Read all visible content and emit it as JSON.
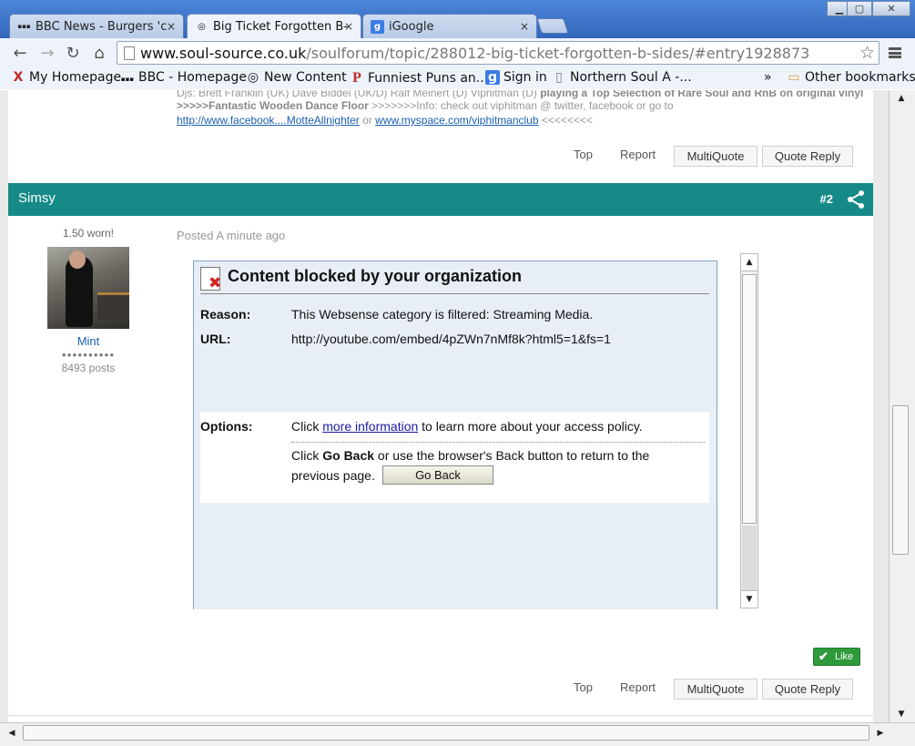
{
  "tabs": [
    {
      "icon": "bbc-favicon-icon",
      "label": "BBC News - Burgers 'c",
      "close": "×"
    },
    {
      "icon": "soul-source-favicon-icon",
      "label": "Big Ticket Forgotten B-",
      "close": "×"
    },
    {
      "icon": "google-favicon-icon",
      "label": "iGoogle",
      "close": "×"
    }
  ],
  "window_controls": {
    "minimize": "▁",
    "maximize": "▢",
    "close": "✕"
  },
  "toolbar": {
    "back": "←",
    "forward": "→",
    "reload": "↻",
    "home": "⌂",
    "url_host": "www.soul-source.co.uk",
    "url_path": "/soulforum/topic/288012-big-ticket-forgotten-b-sides/#entry1928873",
    "star": "☆"
  },
  "bookmarks": [
    {
      "icon": "x-favicon-icon",
      "glyph": "X",
      "label": "My Homepage"
    },
    {
      "icon": "bbc-favicon-icon",
      "glyph": "▪▪▪",
      "label": "BBC - Homepage"
    },
    {
      "icon": "soul-source-favicon-icon",
      "glyph": "◎",
      "label": "New Content"
    },
    {
      "icon": "p-favicon-icon",
      "glyph": "P",
      "label": "Funniest Puns an..."
    },
    {
      "icon": "google-favicon-icon",
      "glyph": "g",
      "label": "Sign in"
    },
    {
      "icon": "page-icon",
      "glyph": "▯",
      "label": "Northern Soul A -..."
    }
  ],
  "bookmarks_overflow": "»",
  "other_bookmarks": "Other bookmarks",
  "prev_post": {
    "line1": "Djs: Brett Franklin (UK) Dave Biddel (UK/D) Ralf Meinert (D) Viphitman (D)",
    "line1_bold": "playing a Top Selection of Rare Soul and RnB on original vinyl",
    "line2_bold": ">>>>>Fantastic Wooden Dance Floor",
    "line2": " >>>>>>>Info: check out viphitman @ twitter, facebook or go to",
    "link1": "http://www.facebook....MotteAllnighter",
    "or": " or ",
    "link2": " www.myspace.com/viphitmanclub",
    "tail": " <<<<<<<<"
  },
  "actions": {
    "top": "Top",
    "report": "Report",
    "multiquote": "MultiQuote",
    "quote_reply": "Quote Reply"
  },
  "post": {
    "author": "Simsy",
    "number": "#2",
    "reputation": "1.50 worn!",
    "member_title": "Mint",
    "pips": "●●●●●●●●●●",
    "post_count": "8493 posts",
    "posted": "Posted A minute ago"
  },
  "blocked": {
    "title": "Content blocked by your organization",
    "reason_label": "Reason:",
    "reason_value": "This Websense category is filtered: Streaming Media.",
    "url_label": "URL:",
    "url_value": "http://youtube.com/embed/4pZWn7nMf8k?html5=1&fs=1",
    "options_label": "Options:",
    "options_pre": "Click ",
    "options_link": "more information",
    "options_post": " to learn more about your access policy.",
    "line2_pre": "Click ",
    "line2_bold": "Go Back",
    "line2_post": " or use the browser's Back button to return to the",
    "line3": "previous page.",
    "go_back": "Go Back"
  },
  "like": {
    "tick": "✔",
    "label": "Like"
  },
  "scroll": {
    "up": "▲",
    "down": "▼",
    "left": "◀",
    "right": "▶"
  }
}
